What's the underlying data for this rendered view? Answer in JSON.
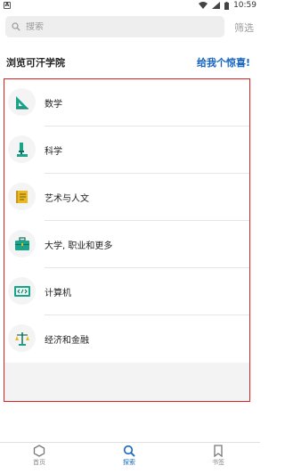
{
  "status_bar": {
    "app_badge": "A",
    "time": "10:59"
  },
  "search": {
    "placeholder": "搜索",
    "filter_label": "筛选"
  },
  "header": {
    "title": "浏览可汗学院",
    "surprise_link": "给我个惊喜!"
  },
  "categories": [
    {
      "label": "数学",
      "icon": "triangle-ruler-icon"
    },
    {
      "label": "科学",
      "icon": "microscope-icon"
    },
    {
      "label": "艺术与人文",
      "icon": "scroll-icon"
    },
    {
      "label": "大学, 职业和更多",
      "icon": "briefcase-icon"
    },
    {
      "label": "计算机",
      "icon": "code-monitor-icon"
    },
    {
      "label": "经济和金融",
      "icon": "balance-scale-icon"
    }
  ],
  "bottom_nav": [
    {
      "label": "首页",
      "icon": "home-hexagon-icon",
      "active": false
    },
    {
      "label": "探索",
      "icon": "search-icon",
      "active": true
    },
    {
      "label": "书签",
      "icon": "bookmark-icon",
      "active": false
    }
  ],
  "colors": {
    "accent": "#1565c0",
    "highlight_border": "#e02020",
    "icon_teal": "#1aa58b"
  }
}
